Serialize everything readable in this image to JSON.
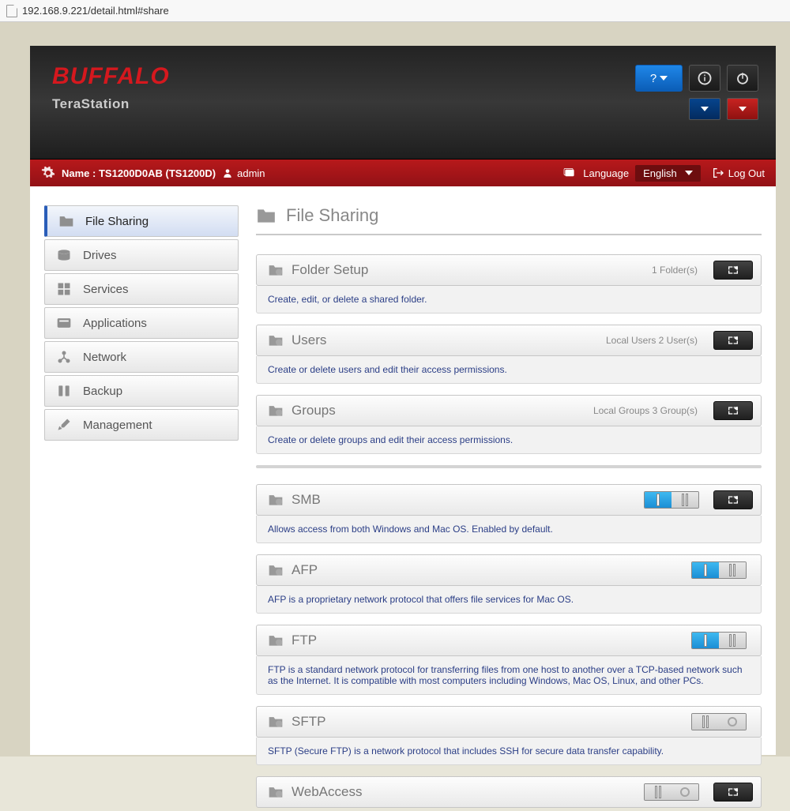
{
  "url": "192.168.9.221/detail.html#share",
  "header": {
    "brand": "BUFFALO",
    "product": "TeraStation",
    "help_label": "?",
    "name_label": "Name :",
    "device_name": "TS1200D0AB (TS1200D)",
    "user": "admin",
    "language_label": "Language",
    "language_value": "English",
    "logout_label": "Log Out"
  },
  "sidebar": [
    {
      "label": "File Sharing",
      "active": true,
      "icon": "folder"
    },
    {
      "label": "Drives",
      "icon": "drive"
    },
    {
      "label": "Services",
      "icon": "services"
    },
    {
      "label": "Applications",
      "icon": "apps"
    },
    {
      "label": "Network",
      "icon": "network"
    },
    {
      "label": "Backup",
      "icon": "backup"
    },
    {
      "label": "Management",
      "icon": "management"
    }
  ],
  "page": {
    "title": "File Sharing",
    "group1": [
      {
        "title": "Folder Setup",
        "count": "1 Folder(s)",
        "desc": "Create, edit, or delete a shared folder.",
        "expand": true
      },
      {
        "title": "Users",
        "count": "Local Users 2 User(s)",
        "desc": "Create or delete users and edit their access permissions.",
        "expand": true
      },
      {
        "title": "Groups",
        "count": "Local Groups 3 Group(s)",
        "desc": "Create or delete groups and edit their access permissions.",
        "expand": true
      }
    ],
    "group2": [
      {
        "title": "SMB",
        "toggle": "on",
        "expand": true,
        "desc": "Allows access from both Windows and Mac OS. Enabled by default."
      },
      {
        "title": "AFP",
        "toggle": "on",
        "expand": false,
        "desc": "AFP is a proprietary network protocol that offers file services for Mac OS."
      },
      {
        "title": "FTP",
        "toggle": "on",
        "expand": false,
        "desc": "FTP is a standard network protocol for transferring files from one host to another over a TCP-based network such as the Internet. It is compatible with most computers including Windows, Mac OS, Linux, and other PCs."
      },
      {
        "title": "SFTP",
        "toggle": "off",
        "expand": false,
        "desc": "SFTP (Secure FTP) is a network protocol that includes SSH for secure data transfer capability."
      },
      {
        "title": "WebAccess",
        "toggle": "off",
        "expand": true,
        "desc": ""
      }
    ]
  }
}
